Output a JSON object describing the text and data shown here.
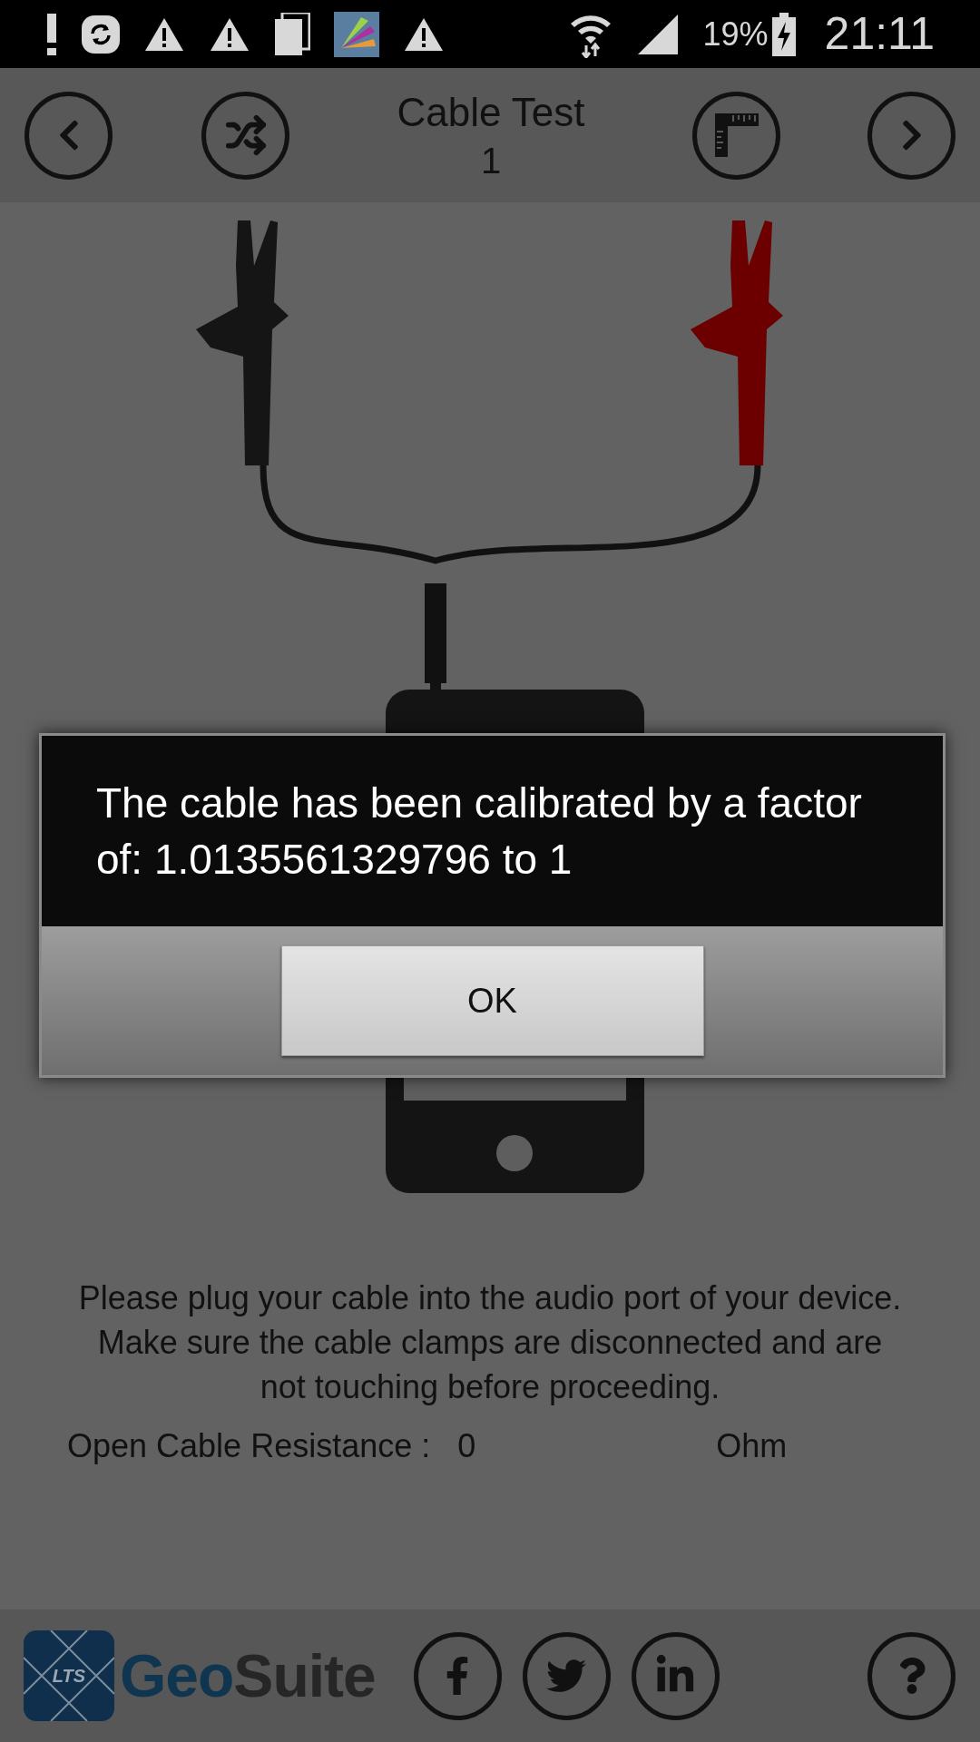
{
  "status_bar": {
    "battery": "19%",
    "time": "21:11"
  },
  "header": {
    "title": "Cable Test",
    "subtitle": "1"
  },
  "dialog": {
    "message": "The cable has been calibrated by a factor of: 1.0135561329796 to 1",
    "button": "OK"
  },
  "instructions": "Please plug your cable into the audio port of your device. Make sure the cable clamps are disconnected and are not touching before proceeding.",
  "resistance": {
    "label": "Open Cable Resistance :",
    "value": "0",
    "unit": "Ohm"
  },
  "footer": {
    "logo_badge": "LTS",
    "logo_parts": [
      "Geo",
      "Suite"
    ]
  }
}
